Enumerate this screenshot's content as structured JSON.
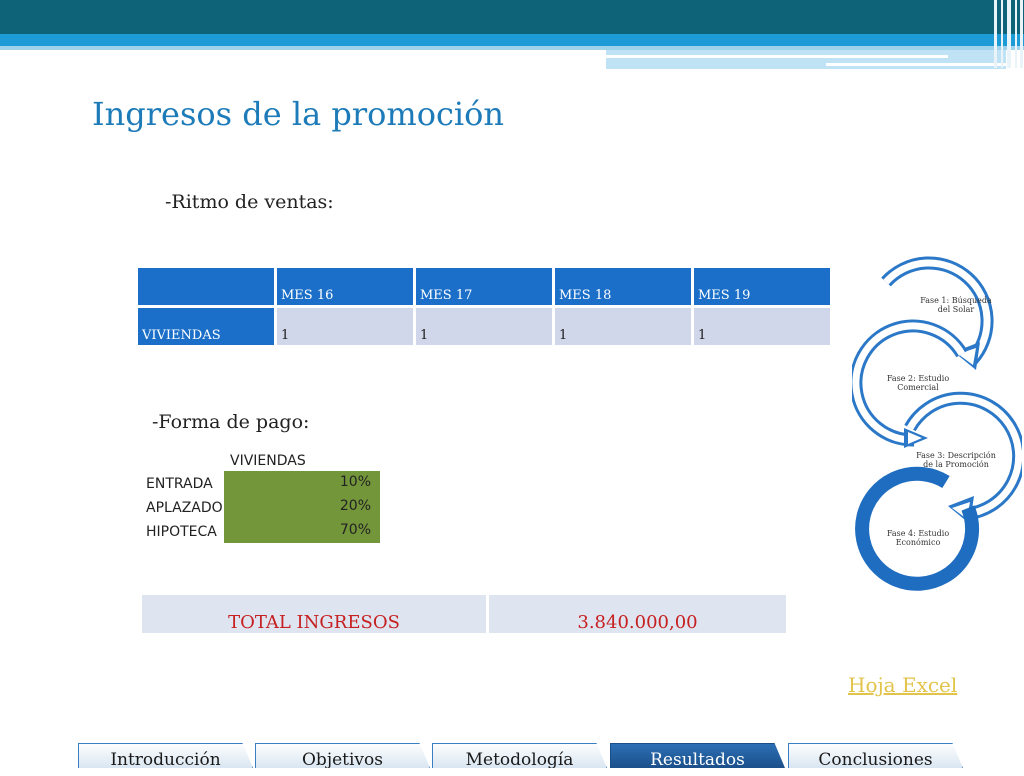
{
  "slide": {
    "title": "Ingresos de la promoción",
    "sections": {
      "sales_rhythm": "-Ritmo de ventas:",
      "payment_form": "-Forma de pago:"
    }
  },
  "sales_table": {
    "header": [
      "",
      "MES 16",
      "MES 17",
      "MES 18",
      "MES 19"
    ],
    "rows": [
      {
        "label": "VIVIENDAS",
        "values": [
          "1",
          "1",
          "1",
          "1"
        ]
      }
    ]
  },
  "payment_table": {
    "header": "VIVIENDAS",
    "rows": [
      {
        "label": "ENTRADA",
        "value": "10%"
      },
      {
        "label": "APLAZADO",
        "value": "20%"
      },
      {
        "label": "HIPOTECA",
        "value": "70%"
      }
    ]
  },
  "total": {
    "label": "TOTAL INGRESOS",
    "value": "3.840.000,00"
  },
  "excel_link": "Hoja Excel",
  "phases": [
    {
      "line1": "Fase 1: Búsqueda",
      "line2": "del  Solar"
    },
    {
      "line1": "Fase 2: Estudio",
      "line2": "Comercial"
    },
    {
      "line1": "Fase 3: Descripción",
      "line2": "de la      Promoción"
    },
    {
      "line1": "Fase 4: Estudio",
      "line2": "Económico"
    }
  ],
  "nav_tabs": [
    {
      "label": "Introducción",
      "active": false
    },
    {
      "label": "Objetivos",
      "active": false
    },
    {
      "label": "Metodología",
      "active": false
    },
    {
      "label": "Resultados",
      "active": true
    },
    {
      "label": "Conclusiones",
      "active": false
    }
  ],
  "colors": {
    "header_dark": "#0f6378",
    "header_blue": "#1d9bd6",
    "title": "#1c7bb8",
    "table_header": "#1b6fc8",
    "table_body": "#d0d7ea",
    "payment_fill": "#74963b",
    "total_text": "#c62020",
    "link": "#e2c44a",
    "phase_arrow": "#2a78c7"
  }
}
